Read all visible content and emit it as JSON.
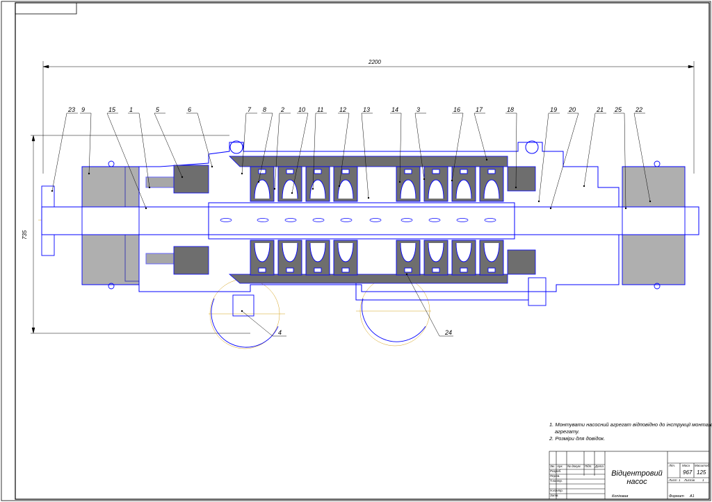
{
  "drawing": {
    "overall_length_dim": "2200",
    "overall_height_dim": "735",
    "part_labels_top": [
      "23",
      "9",
      "15",
      "1",
      "5",
      "6",
      "7",
      "8",
      "2",
      "10",
      "11",
      "12",
      "13",
      "14",
      "3",
      "16",
      "17",
      "18",
      "19",
      "20",
      "21",
      "25",
      "22"
    ],
    "part_labels_bottom": [
      "4",
      "24"
    ],
    "colors": {
      "line": "#0000ff",
      "axis": "#d4a017",
      "fill": "#6e6e6e",
      "frame": "#000000"
    }
  },
  "notes": {
    "items": [
      "1. Монтувати насосний агрегат відповідно до інструкції монтажу",
      "агрегату.",
      "2. Розміри для довідок."
    ]
  },
  "title_block": {
    "title": "Відцентровий насос",
    "col_lit": "Літ.",
    "col_mass": "Маса",
    "col_scale": "Масштаб",
    "mass": "967",
    "scale": "125",
    "sheet_label": "Лист",
    "sheet_no": "1",
    "sheets_label": "Листів",
    "sheets_no": "1",
    "rows": [
      "Зм.",
      "Арк.",
      "№ докум.",
      "Підп.",
      "Дата",
      "Розроб.",
      "Перев.",
      "Т.контр.",
      "Н.контр.",
      "Затв."
    ]
  },
  "footer": {
    "copy": "Копіював",
    "format": "Формат",
    "format_value": "А1"
  }
}
